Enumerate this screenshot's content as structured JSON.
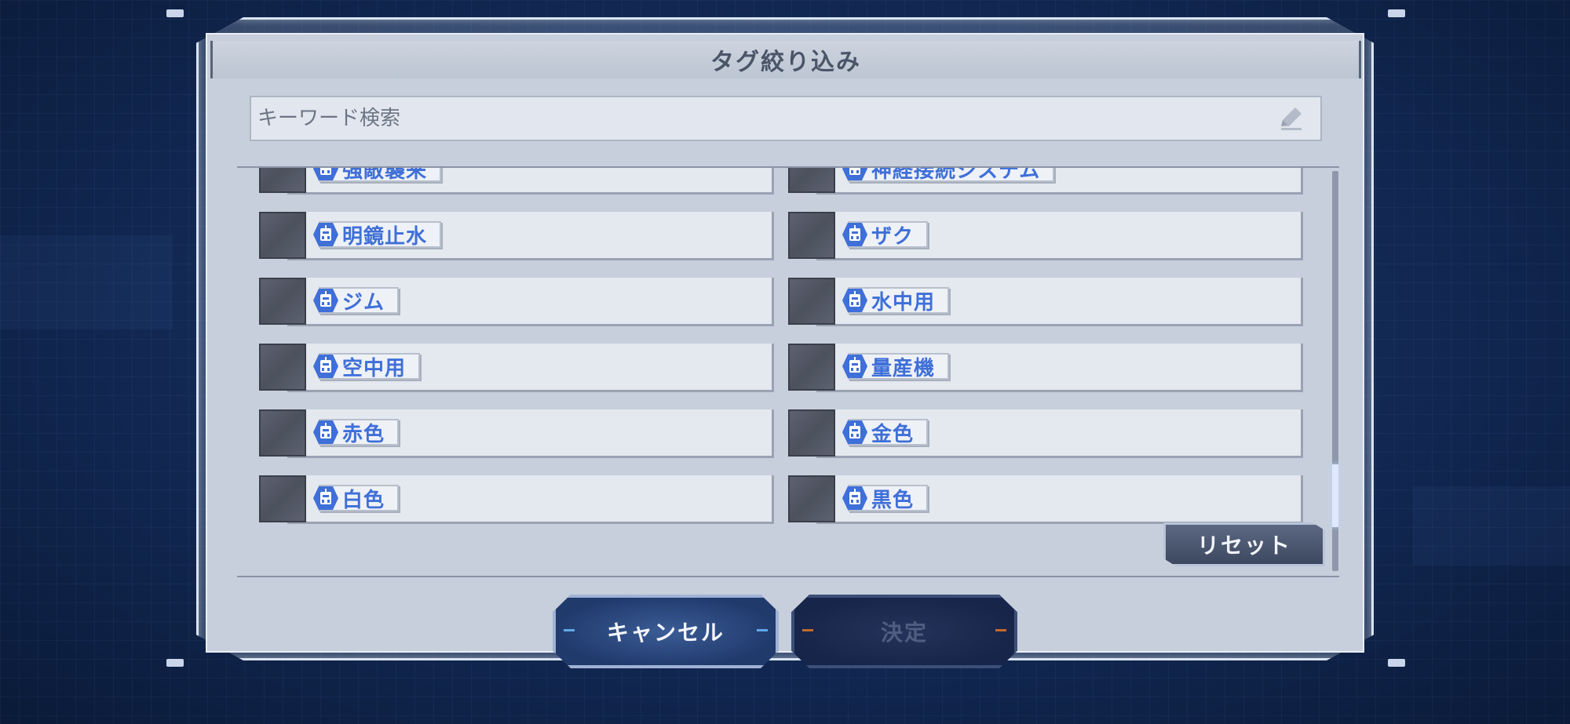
{
  "dialog": {
    "title": "タグ絞り込み",
    "search_placeholder": "キーワード検索",
    "reset_label": "リセット",
    "cancel_label": "キャンセル",
    "confirm_label": "決定"
  },
  "tags": {
    "left": [
      "強敵襲来",
      "明鏡止水",
      "ジム",
      "空中用",
      "赤色",
      "白色"
    ],
    "right": [
      "神経接続システム",
      "ザク",
      "水中用",
      "量産機",
      "金色",
      "黒色"
    ]
  },
  "colors": {
    "accent": "#3f6fd8",
    "panel": "#c7cfdc",
    "background": "#142c5a"
  },
  "icons": {
    "tag": "mobile-suit-head-icon",
    "search": "pencil-icon"
  },
  "scroll": {
    "position_fraction": 0.87
  }
}
